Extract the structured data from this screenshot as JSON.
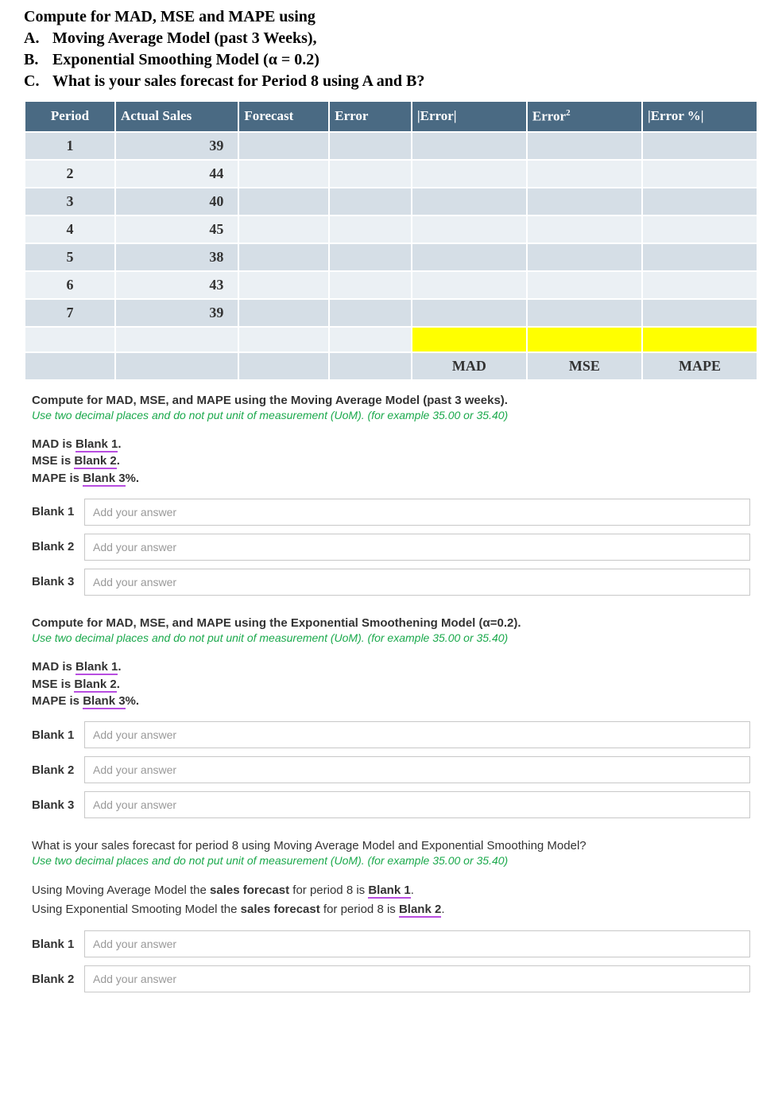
{
  "header": {
    "title": "Compute for MAD, MSE and MAPE using",
    "items": [
      {
        "marker": "A.",
        "text": "Moving Average Model (past 3 Weeks),"
      },
      {
        "marker": "B.",
        "text": "Exponential Smoothing Model (α = 0.2)"
      },
      {
        "marker": "C.",
        "text": "What is your sales forecast for Period 8 using A and B?"
      }
    ]
  },
  "table": {
    "headers": {
      "period": "Period",
      "actual": "Actual Sales",
      "forecast": "Forecast",
      "error": "Error",
      "abserror": "|Error|",
      "errsq_base": "Error",
      "errsq_sup": "2",
      "errpct": "|Error %|"
    },
    "rows": [
      {
        "period": "1",
        "actual": "39"
      },
      {
        "period": "2",
        "actual": "44"
      },
      {
        "period": "3",
        "actual": "40"
      },
      {
        "period": "4",
        "actual": "45"
      },
      {
        "period": "5",
        "actual": "38"
      },
      {
        "period": "6",
        "actual": "43"
      },
      {
        "period": "7",
        "actual": "39"
      }
    ],
    "footer": {
      "mad": "MAD",
      "mse": "MSE",
      "mape": "MAPE"
    }
  },
  "q1": {
    "heading": "Compute for MAD, MSE, and MAPE using the Moving Average Model (past 3 weeks).",
    "sub": "Use two decimal places and do not put unit of measurement (UoM). (for example 35.00 or 35.40)",
    "statements": {
      "s1_pre": "MAD is ",
      "s1_link": "Blank 1",
      "s1_post": ".",
      "s2_pre": "MSE is ",
      "s2_link": "Blank 2",
      "s2_post": ".",
      "s3_pre": "MAPE is ",
      "s3_link": "Blank 3",
      "s3_post": "%."
    },
    "blanks": [
      {
        "label": "Blank 1",
        "placeholder": "Add your answer"
      },
      {
        "label": "Blank 2",
        "placeholder": "Add your answer"
      },
      {
        "label": "Blank 3",
        "placeholder": "Add your answer"
      }
    ]
  },
  "q2": {
    "heading": "Compute for MAD, MSE, and MAPE using the Exponential Smoothening Model (α=0.2).",
    "sub": "Use two decimal places and do not put unit of measurement (UoM). (for example 35.00 or 35.40)",
    "statements": {
      "s1_pre": "MAD is ",
      "s1_link": "Blank 1",
      "s1_post": ".",
      "s2_pre": "MSE is ",
      "s2_link": "Blank 2",
      "s2_post": ".",
      "s3_pre": "MAPE is ",
      "s3_link": "Blank 3",
      "s3_post": "%."
    },
    "blanks": [
      {
        "label": "Blank 1",
        "placeholder": "Add your answer"
      },
      {
        "label": "Blank 2",
        "placeholder": "Add your answer"
      },
      {
        "label": "Blank 3",
        "placeholder": "Add your answer"
      }
    ]
  },
  "q3": {
    "heading": "What is your sales forecast for period 8 using Moving Average Model and Exponential Smoothing Model?",
    "sub": "Use two decimal places and do not put unit of measurement (UoM). (for example 35.00 or 35.40)",
    "statements": {
      "s1_pre": "Using Moving Average Model the ",
      "s1_bold": "sales forecast",
      "s1_mid": " for period 8 is ",
      "s1_link": "Blank 1",
      "s1_post": ".",
      "s2_pre": "Using Exponential Smooting Model the ",
      "s2_bold": "sales forecast",
      "s2_mid": " for period 8 is ",
      "s2_link": "Blank 2",
      "s2_post": "."
    },
    "blanks": [
      {
        "label": "Blank 1",
        "placeholder": "Add your answer"
      },
      {
        "label": "Blank 2",
        "placeholder": "Add your answer"
      }
    ]
  }
}
